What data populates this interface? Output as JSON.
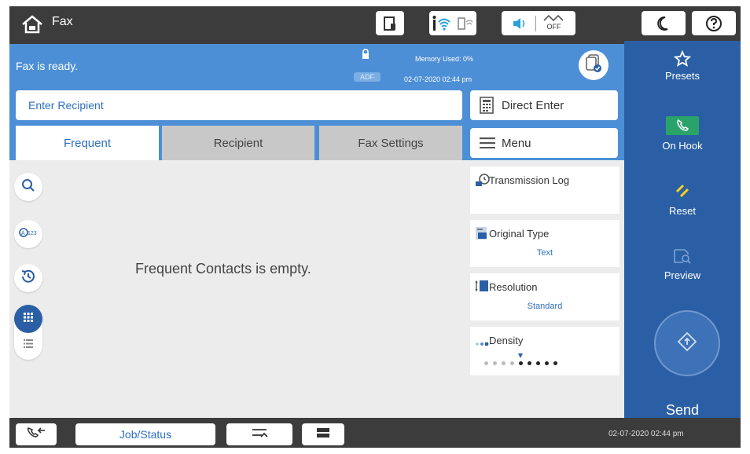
{
  "app": {
    "title": "Fax",
    "home_icon": "home-icon"
  },
  "topbar": {
    "icons": [
      "paper-icon",
      "wifi-icon",
      "wifi-direct-icon",
      "sound-icon",
      "energy-saver-off-icon",
      "sleep-icon",
      "help-icon"
    ],
    "energy_label": "OFF"
  },
  "status": {
    "message": "Fax is ready.",
    "adf_label": "ADF",
    "memory": "Memory Used: 0%",
    "datetime": "02-07-2020 02:44 pm"
  },
  "recipient": {
    "placeholder": "Enter Recipient"
  },
  "buttons": {
    "direct_enter": "Direct Enter",
    "menu": "Menu"
  },
  "tabs": [
    {
      "label": "Frequent",
      "active": true
    },
    {
      "label": "Recipient",
      "active": false
    },
    {
      "label": "Fax Settings",
      "active": false
    }
  ],
  "main": {
    "empty_message": "Frequent Contacts is empty."
  },
  "settings": {
    "transmission_log": "Transmission Log",
    "original_type": {
      "label": "Original Type",
      "value": "Text"
    },
    "resolution": {
      "label": "Resolution",
      "value": "Standard"
    },
    "density": {
      "label": "Density",
      "level": 5,
      "steps": 9
    }
  },
  "sidebar": {
    "presets": "Presets",
    "on_hook": "On Hook",
    "reset": "Reset",
    "preview": "Preview",
    "send": "Send"
  },
  "bottom": {
    "job_status": "Job/Status",
    "datetime": "02-07-2020 02:44 pm"
  },
  "colors": {
    "status_blue": "#4d8fd6",
    "sidebar_blue": "#2a5fa5",
    "accent_text": "#2e6fbf",
    "on_hook_green": "#2aa36b",
    "reset_yellow": "#f2d31a"
  }
}
